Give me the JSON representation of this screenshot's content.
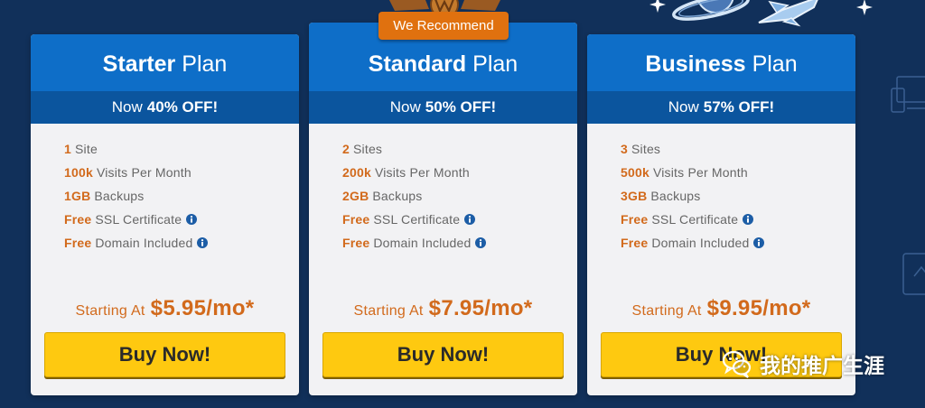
{
  "colors": {
    "page_background": "#11305a",
    "header_blue": "#0e6ec8",
    "band_blue": "#0b559e",
    "card_body": "#f2f2f4",
    "accent_orange": "#d26a1c",
    "badge_orange": "#e0710f",
    "button_yellow": "#fec910",
    "button_text": "#2a2a2a",
    "feature_text": "#666666",
    "info_blue": "#1c5da6"
  },
  "badge": {
    "label": "We Recommend",
    "logo": "wordpress-logo"
  },
  "plans": [
    {
      "name_bold": "Starter",
      "name_suffix": "Plan",
      "discount_prefix": "Now",
      "discount_value": "40% OFF!",
      "features": [
        {
          "highlight": "1",
          "text": "Site"
        },
        {
          "highlight": "100k",
          "text": "Visits Per Month"
        },
        {
          "highlight": "1GB",
          "text": "Backups"
        },
        {
          "highlight": "Free",
          "text": "SSL Certificate",
          "icon": "info-icon"
        },
        {
          "highlight": "Free",
          "text": "Domain Included",
          "icon": "info-icon"
        }
      ],
      "price_prefix": "Starting At",
      "price": "$5.95/mo*",
      "button_label": "Buy Now!",
      "recommended": false
    },
    {
      "name_bold": "Standard",
      "name_suffix": "Plan",
      "discount_prefix": "Now",
      "discount_value": "50% OFF!",
      "features": [
        {
          "highlight": "2",
          "text": "Sites"
        },
        {
          "highlight": "200k",
          "text": "Visits Per Month"
        },
        {
          "highlight": "2GB",
          "text": "Backups"
        },
        {
          "highlight": "Free",
          "text": "SSL Certificate",
          "icon": "info-icon"
        },
        {
          "highlight": "Free",
          "text": "Domain Included",
          "icon": "info-icon"
        }
      ],
      "price_prefix": "Starting At",
      "price": "$7.95/mo*",
      "button_label": "Buy Now!",
      "recommended": true
    },
    {
      "name_bold": "Business",
      "name_suffix": "Plan",
      "discount_prefix": "Now",
      "discount_value": "57% OFF!",
      "features": [
        {
          "highlight": "3",
          "text": "Sites"
        },
        {
          "highlight": "500k",
          "text": "Visits Per Month"
        },
        {
          "highlight": "3GB",
          "text": "Backups"
        },
        {
          "highlight": "Free",
          "text": "SSL Certificate",
          "icon": "info-icon"
        },
        {
          "highlight": "Free",
          "text": "Domain Included",
          "icon": "info-icon"
        }
      ],
      "price_prefix": "Starting At",
      "price": "$9.95/mo*",
      "button_label": "Buy Now!",
      "recommended": false
    }
  ],
  "watermark": {
    "text": "我的推广生涯",
    "icon": "wechat-icon"
  },
  "decorations": {
    "top_right": [
      "sparkle-icon",
      "planet-icon",
      "rocket-icon",
      "sparkle-icon"
    ],
    "right_edge": [
      "devices-icon",
      "document-icon"
    ]
  }
}
